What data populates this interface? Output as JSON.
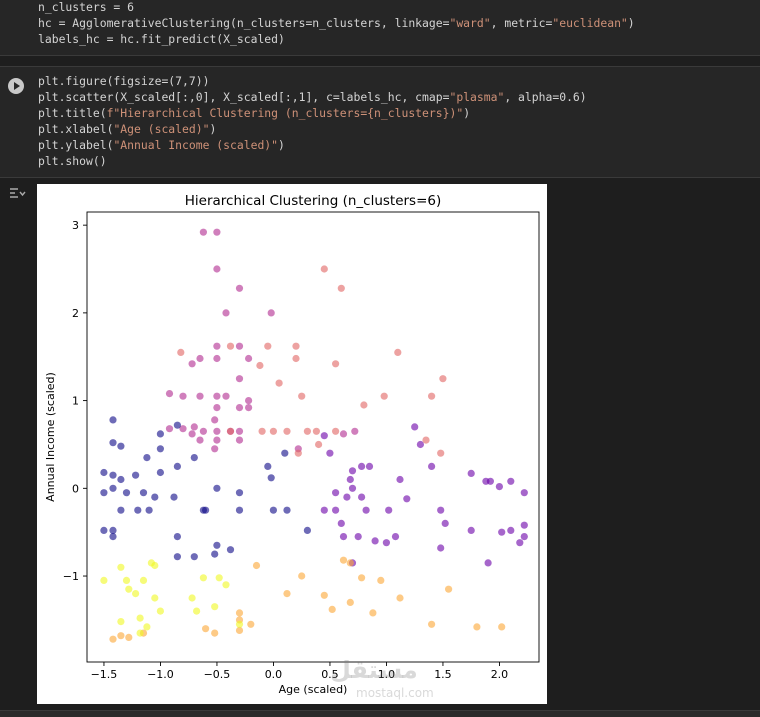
{
  "cell1": {
    "lines": [
      "n_clusters = 6",
      "hc = AgglomerativeClustering(n_clusters=n_clusters, linkage=\"ward\", metric=\"euclidean\")",
      "labels_hc = hc.fit_predict(X_scaled)"
    ]
  },
  "cell2": {
    "run_icon": "play-icon",
    "lines": [
      "plt.figure(figsize=(7,7))",
      "plt.scatter(X_scaled[:,0], X_scaled[:,1], c=labels_hc, cmap=\"plasma\", alpha=0.6)",
      "plt.title(f\"Hierarchical Clustering (n_clusters={n_clusters})\")",
      "plt.xlabel(\"Age (scaled)\")",
      "plt.ylabel(\"Annual Income (scaled)\")",
      "plt.show()"
    ]
  },
  "output": {
    "icon": "output-toggle-icon"
  },
  "watermark": {
    "main": "مستقل",
    "sub": "mostaql.com"
  },
  "chart_data": {
    "type": "scatter",
    "title": "Hierarchical Clustering (n_clusters=6)",
    "xlabel": "Age (scaled)",
    "ylabel": "Annual Income (scaled)",
    "xlim": [
      -1.65,
      2.35
    ],
    "ylim": [
      -1.98,
      3.15
    ],
    "xticks": [
      -1.5,
      -1.0,
      -0.5,
      0.0,
      0.5,
      1.0,
      1.5,
      2.0
    ],
    "xtick_labels": [
      "−1.5",
      "−1.0",
      "−0.5",
      "0.0",
      "0.5",
      "1.0",
      "1.5",
      "2.0"
    ],
    "yticks": [
      -1,
      0,
      1,
      2,
      3
    ],
    "ytick_labels": [
      "−1",
      "0",
      "1",
      "2",
      "3"
    ],
    "grid": false,
    "alpha": 0.6,
    "cluster_colors": [
      "#0d0887",
      "#6a00a8",
      "#b12a90",
      "#e16462",
      "#fca636",
      "#f0f921"
    ],
    "points": [
      [
        -0.62,
        2.92,
        2
      ],
      [
        -0.5,
        2.92,
        2
      ],
      [
        -0.5,
        2.5,
        2
      ],
      [
        -0.3,
        2.28,
        2
      ],
      [
        -0.42,
        2.0,
        2
      ],
      [
        -0.02,
        2.0,
        2
      ],
      [
        -0.65,
        1.48,
        2
      ],
      [
        -0.72,
        1.42,
        2
      ],
      [
        -0.5,
        1.62,
        2
      ],
      [
        -0.5,
        1.48,
        2
      ],
      [
        -0.3,
        1.62,
        2
      ],
      [
        -0.22,
        1.48,
        2
      ],
      [
        -0.92,
        1.08,
        2
      ],
      [
        -0.8,
        1.05,
        2
      ],
      [
        -0.65,
        1.05,
        2
      ],
      [
        -0.5,
        1.05,
        2
      ],
      [
        -0.42,
        1.05,
        2
      ],
      [
        -0.3,
        1.25,
        2
      ],
      [
        -0.22,
        1.0,
        2
      ],
      [
        -0.22,
        0.92,
        2
      ],
      [
        -0.3,
        0.92,
        2
      ],
      [
        -0.5,
        0.92,
        2
      ],
      [
        -0.52,
        0.78,
        2
      ],
      [
        -0.7,
        0.7,
        2
      ],
      [
        -0.8,
        0.68,
        2
      ],
      [
        -0.92,
        0.68,
        2
      ],
      [
        -0.62,
        0.65,
        2
      ],
      [
        -0.5,
        0.65,
        2
      ],
      [
        -0.38,
        0.65,
        2
      ],
      [
        -0.3,
        0.65,
        2
      ],
      [
        -0.5,
        0.55,
        2
      ],
      [
        -0.52,
        0.45,
        2
      ],
      [
        -0.65,
        0.55,
        2
      ],
      [
        -0.72,
        0.62,
        2
      ],
      [
        0.72,
        0.65,
        2
      ],
      [
        0.62,
        0.62,
        2
      ],
      [
        0.22,
        0.45,
        2
      ],
      [
        -0.3,
        0.55,
        2
      ],
      [
        -0.82,
        1.55,
        3
      ],
      [
        -0.38,
        1.62,
        3
      ],
      [
        -0.05,
        1.62,
        3
      ],
      [
        0.2,
        1.62,
        3
      ],
      [
        0.2,
        1.48,
        3
      ],
      [
        0.55,
        1.42,
        3
      ],
      [
        0.45,
        2.5,
        3
      ],
      [
        0.6,
        2.28,
        3
      ],
      [
        1.1,
        1.55,
        3
      ],
      [
        1.5,
        1.25,
        3
      ],
      [
        -0.12,
        1.4,
        3
      ],
      [
        0.05,
        1.2,
        3
      ],
      [
        0.25,
        1.05,
        3
      ],
      [
        -0.38,
        0.65,
        3
      ],
      [
        -0.1,
        0.65,
        3
      ],
      [
        0.0,
        0.65,
        3
      ],
      [
        0.12,
        0.65,
        3
      ],
      [
        0.3,
        0.65,
        3
      ],
      [
        0.38,
        0.65,
        3
      ],
      [
        0.55,
        0.65,
        3
      ],
      [
        0.4,
        0.5,
        3
      ],
      [
        0.8,
        0.95,
        3
      ],
      [
        0.98,
        1.05,
        3
      ],
      [
        1.4,
        1.05,
        3
      ],
      [
        1.35,
        0.55,
        3
      ],
      [
        1.48,
        0.4,
        3
      ],
      [
        0.22,
        0.4,
        3
      ],
      [
        -1.42,
        0.78,
        0
      ],
      [
        -1.42,
        0.52,
        0
      ],
      [
        -1.35,
        0.48,
        0
      ],
      [
        -1.0,
        0.62,
        0
      ],
      [
        -1.0,
        0.45,
        0
      ],
      [
        -1.12,
        0.35,
        0
      ],
      [
        -0.85,
        0.72,
        0
      ],
      [
        -0.85,
        0.25,
        0
      ],
      [
        -1.5,
        0.18,
        0
      ],
      [
        -1.42,
        0.15,
        0
      ],
      [
        -1.35,
        0.1,
        0
      ],
      [
        -1.42,
        0.0,
        0
      ],
      [
        -1.3,
        -0.05,
        0
      ],
      [
        -1.15,
        -0.05,
        0
      ],
      [
        -1.22,
        0.15,
        0
      ],
      [
        -1.0,
        0.18,
        0
      ],
      [
        -0.88,
        -0.1,
        0
      ],
      [
        -1.05,
        -0.1,
        0
      ],
      [
        -1.5,
        -0.05,
        0
      ],
      [
        -1.35,
        -0.25,
        0
      ],
      [
        -1.2,
        -0.25,
        0
      ],
      [
        -1.1,
        -0.25,
        0
      ],
      [
        -1.42,
        -0.48,
        0
      ],
      [
        -1.5,
        -0.48,
        0
      ],
      [
        -1.42,
        -0.55,
        0
      ],
      [
        -0.85,
        -0.55,
        0
      ],
      [
        -0.85,
        -0.78,
        0
      ],
      [
        -0.7,
        -0.78,
        0
      ],
      [
        -0.5,
        -0.65,
        0
      ],
      [
        -0.52,
        -0.75,
        0
      ],
      [
        -0.38,
        -0.7,
        0
      ],
      [
        -0.5,
        0.0,
        0
      ],
      [
        -0.3,
        -0.05,
        0
      ],
      [
        -0.05,
        0.25,
        0
      ],
      [
        -0.02,
        0.12,
        0
      ],
      [
        0.1,
        0.4,
        0
      ],
      [
        0.0,
        -0.25,
        0
      ],
      [
        -0.3,
        -0.25,
        0
      ],
      [
        0.12,
        -0.25,
        0
      ],
      [
        0.3,
        -0.48,
        0
      ],
      [
        -0.7,
        0.35,
        0
      ],
      [
        -0.62,
        -0.25,
        0
      ],
      [
        -0.6,
        -0.25,
        0
      ],
      [
        0.45,
        0.6,
        1
      ],
      [
        0.5,
        0.4,
        1
      ],
      [
        0.7,
        0.2,
        1
      ],
      [
        0.7,
        0.0,
        1
      ],
      [
        0.55,
        -0.05,
        1
      ],
      [
        0.78,
        0.25,
        1
      ],
      [
        0.85,
        0.25,
        1
      ],
      [
        0.78,
        -0.1,
        1
      ],
      [
        0.65,
        -0.1,
        1
      ],
      [
        0.68,
        0.1,
        1
      ],
      [
        0.55,
        -0.25,
        1
      ],
      [
        0.45,
        -0.25,
        1
      ],
      [
        0.6,
        -0.4,
        1
      ],
      [
        0.62,
        -0.55,
        1
      ],
      [
        0.75,
        -0.55,
        1
      ],
      [
        0.9,
        -0.6,
        1
      ],
      [
        1.0,
        -0.62,
        1
      ],
      [
        1.08,
        -0.55,
        1
      ],
      [
        1.02,
        -0.25,
        1
      ],
      [
        1.12,
        0.1,
        1
      ],
      [
        1.25,
        0.7,
        1
      ],
      [
        1.3,
        0.5,
        1
      ],
      [
        1.4,
        0.25,
        1
      ],
      [
        1.48,
        -0.25,
        1
      ],
      [
        1.52,
        -0.4,
        1
      ],
      [
        1.48,
        -0.68,
        1
      ],
      [
        1.18,
        -0.12,
        1
      ],
      [
        0.82,
        -0.25,
        1
      ],
      [
        0.7,
        -0.85,
        1
      ],
      [
        1.75,
        0.17,
        1
      ],
      [
        1.75,
        -0.48,
        1
      ],
      [
        1.88,
        0.08,
        1
      ],
      [
        1.92,
        0.08,
        1
      ],
      [
        2.0,
        0.02,
        1
      ],
      [
        2.1,
        0.08,
        1
      ],
      [
        2.22,
        -0.05,
        1
      ],
      [
        2.02,
        -0.5,
        1
      ],
      [
        2.1,
        -0.48,
        1
      ],
      [
        2.18,
        -0.62,
        1
      ],
      [
        2.22,
        -0.55,
        1
      ],
      [
        2.22,
        -0.42,
        1
      ],
      [
        1.9,
        -0.85,
        1
      ],
      [
        -1.42,
        -1.72,
        4
      ],
      [
        -1.35,
        -1.68,
        4
      ],
      [
        -1.28,
        -1.7,
        4
      ],
      [
        -1.15,
        -1.65,
        4
      ],
      [
        -0.6,
        -1.6,
        4
      ],
      [
        -0.52,
        -1.65,
        4
      ],
      [
        -0.3,
        -1.62,
        4
      ],
      [
        -0.3,
        -1.5,
        4
      ],
      [
        -0.3,
        -1.42,
        4
      ],
      [
        -0.2,
        -1.55,
        4
      ],
      [
        0.12,
        -1.2,
        4
      ],
      [
        0.25,
        -1.0,
        4
      ],
      [
        0.45,
        -1.22,
        4
      ],
      [
        0.52,
        -1.38,
        4
      ],
      [
        0.68,
        -1.3,
        4
      ],
      [
        0.78,
        -1.02,
        4
      ],
      [
        0.88,
        -1.42,
        4
      ],
      [
        0.95,
        -1.05,
        4
      ],
      [
        1.12,
        -1.25,
        4
      ],
      [
        1.4,
        -1.55,
        4
      ],
      [
        1.55,
        -1.15,
        4
      ],
      [
        1.8,
        -1.58,
        4
      ],
      [
        2.02,
        -1.58,
        4
      ],
      [
        0.68,
        -0.85,
        4
      ],
      [
        0.62,
        -0.82,
        4
      ],
      [
        -0.15,
        -0.88,
        4
      ],
      [
        -1.5,
        -1.05,
        5
      ],
      [
        -1.35,
        -0.9,
        5
      ],
      [
        -1.3,
        -1.05,
        5
      ],
      [
        -1.28,
        -1.15,
        5
      ],
      [
        -1.22,
        -1.2,
        5
      ],
      [
        -1.08,
        -0.85,
        5
      ],
      [
        -1.05,
        -0.88,
        5
      ],
      [
        -1.15,
        -1.05,
        5
      ],
      [
        -1.05,
        -1.25,
        5
      ],
      [
        -1.18,
        -1.48,
        5
      ],
      [
        -1.12,
        -1.58,
        5
      ],
      [
        -1.0,
        -1.4,
        5
      ],
      [
        -1.35,
        -1.52,
        5
      ],
      [
        -1.18,
        -1.65,
        5
      ],
      [
        -0.62,
        -1.02,
        5
      ],
      [
        -0.72,
        -1.25,
        5
      ],
      [
        -0.52,
        -1.35,
        5
      ],
      [
        -0.68,
        -1.4,
        5
      ],
      [
        -0.48,
        -1.02,
        5
      ],
      [
        -0.42,
        -1.1,
        5
      ],
      [
        -0.3,
        -1.55,
        5
      ]
    ]
  }
}
